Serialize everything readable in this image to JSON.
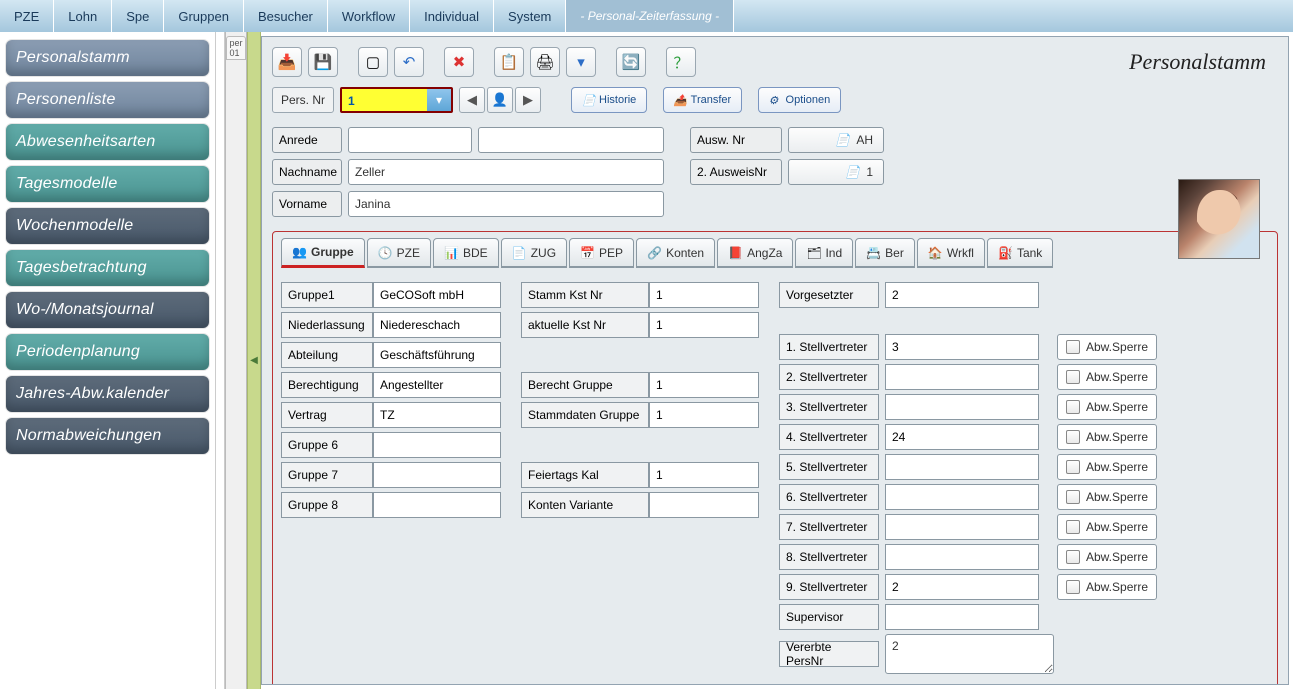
{
  "topmenu": [
    "PZE",
    "Lohn",
    "Spe",
    "Gruppen",
    "Besucher",
    "Workflow",
    "Individual",
    "System"
  ],
  "topactive": "- Personal-Zeiterfassung -",
  "sidebar": {
    "items": [
      {
        "label": "Personalstamm",
        "style": "steel"
      },
      {
        "label": "Personenliste",
        "style": "steel"
      },
      {
        "label": "Abwesenheitsarten",
        "style": "teal"
      },
      {
        "label": "Tagesmodelle",
        "style": "teal"
      },
      {
        "label": "Wochenmodelle",
        "style": "dark"
      },
      {
        "label": "Tagesbetrachtung",
        "style": "teal"
      },
      {
        "label": "Wo-/Monatsjournal",
        "style": "dark"
      },
      {
        "label": "Periodenplanung",
        "style": "teal"
      },
      {
        "label": "Jahres-Abw.kalender",
        "style": "dark"
      },
      {
        "label": "Normabweichungen",
        "style": "dark"
      }
    ]
  },
  "pertag_lines": [
    "per",
    "01"
  ],
  "header_title": "Personalstamm",
  "toolbar_icons": [
    {
      "name": "import-icon",
      "glyph": "📥",
      "cls": "c-orange"
    },
    {
      "name": "save-icon",
      "glyph": "💾",
      "cls": "c-blue"
    },
    {
      "name": "new-icon",
      "glyph": "▢",
      "cls": ""
    },
    {
      "name": "undo-icon",
      "glyph": "↶",
      "cls": "c-blue"
    },
    {
      "name": "delete-icon",
      "glyph": "✖",
      "cls": "c-red"
    },
    {
      "name": "copy-icon",
      "glyph": "📋",
      "cls": "c-blue"
    },
    {
      "name": "print-icon",
      "glyph": "🖨",
      "cls": ""
    },
    {
      "name": "filter-icon",
      "glyph": "▾",
      "cls": "c-blue"
    },
    {
      "name": "refresh-icon",
      "glyph": "🔄",
      "cls": "c-red"
    },
    {
      "name": "help-icon",
      "glyph": "？",
      "cls": "c-green"
    }
  ],
  "persnr": {
    "label": "Pers. Nr",
    "value": "1"
  },
  "pill_buttons": [
    {
      "name": "historie",
      "label": "Historie",
      "glyph": "📄"
    },
    {
      "name": "transfer",
      "label": "Transfer",
      "glyph": "📤"
    },
    {
      "name": "optionen",
      "label": "Optionen",
      "glyph": "⚙"
    }
  ],
  "fields": {
    "anrede_label": "Anrede",
    "anrede": "",
    "nachname_label": "Nachname",
    "nachname": "Zeller",
    "vorname_label": "Vorname",
    "vorname": "Janina",
    "auswnr_label": "Ausw. Nr",
    "auswnr": "AH",
    "ausw2_label": "2. AusweisNr",
    "ausw2": "1"
  },
  "tabs": [
    {
      "name": "gruppe",
      "label": "Gruppe",
      "icon": "👥"
    },
    {
      "name": "pze",
      "label": "PZE",
      "icon": "🕓"
    },
    {
      "name": "bde",
      "label": "BDE",
      "icon": "📊"
    },
    {
      "name": "zug",
      "label": "ZUG",
      "icon": "📄"
    },
    {
      "name": "pep",
      "label": "PEP",
      "icon": "📅"
    },
    {
      "name": "konten",
      "label": "Konten",
      "icon": "🔗"
    },
    {
      "name": "angza",
      "label": "AngZa",
      "icon": "📕"
    },
    {
      "name": "ind",
      "label": "Ind",
      "icon": "🗂"
    },
    {
      "name": "ber",
      "label": "Ber",
      "icon": "📇"
    },
    {
      "name": "wrkfl",
      "label": "Wrkfl",
      "icon": "🏠"
    },
    {
      "name": "tank",
      "label": "Tank",
      "icon": "⛽"
    }
  ],
  "col1": [
    {
      "k": "Gruppe1",
      "v": "GeCOSoft mbH"
    },
    {
      "k": "Niederlassung",
      "v": "Niedereschach"
    },
    {
      "k": "Abteilung",
      "v": "Geschäftsführung"
    },
    {
      "k": "Berechtigung",
      "v": "Angestellter"
    },
    {
      "k": "Vertrag",
      "v": "TZ"
    },
    {
      "k": "Gruppe 6",
      "v": ""
    },
    {
      "k": "Gruppe 7",
      "v": ""
    },
    {
      "k": "Gruppe 8",
      "v": ""
    }
  ],
  "col2": [
    {
      "k": "Stamm Kst Nr",
      "v": "1"
    },
    {
      "k": "aktuelle Kst Nr",
      "v": "1"
    },
    {
      "k": "",
      "v": "",
      "blank": true
    },
    {
      "k": "Berecht Gruppe",
      "v": "1"
    },
    {
      "k": "Stammdaten Gruppe",
      "v": "1"
    },
    {
      "k": "",
      "v": "",
      "blank": true
    },
    {
      "k": "Feiertags Kal",
      "v": "1"
    },
    {
      "k": "Konten Variante",
      "v": ""
    }
  ],
  "col3": {
    "vorgesetzter": {
      "k": "Vorgesetzter",
      "v": "2"
    },
    "stell": [
      {
        "k": "1. Stellvertreter",
        "v": "3"
      },
      {
        "k": "2. Stellvertreter",
        "v": ""
      },
      {
        "k": "3. Stellvertreter",
        "v": ""
      },
      {
        "k": "4. Stellvertreter",
        "v": "24"
      },
      {
        "k": "5. Stellvertreter",
        "v": ""
      },
      {
        "k": "6. Stellvertreter",
        "v": ""
      },
      {
        "k": "7. Stellvertreter",
        "v": ""
      },
      {
        "k": "8. Stellvertreter",
        "v": ""
      },
      {
        "k": "9. Stellvertreter",
        "v": "2"
      }
    ],
    "supervisor": {
      "k": "Supervisor",
      "v": ""
    },
    "vererbte": {
      "k": "Vererbte PersNr",
      "v": "2"
    },
    "sperre_label": "Abw.Sperre"
  }
}
